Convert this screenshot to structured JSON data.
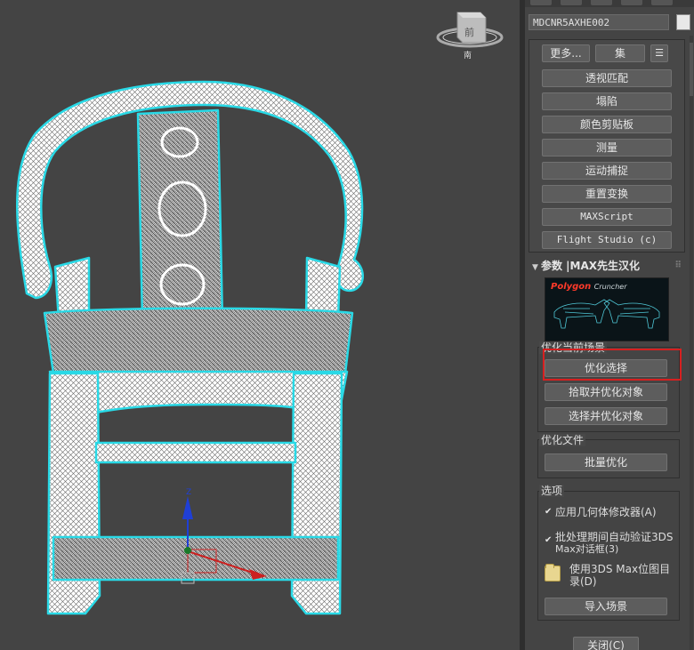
{
  "viewport": {
    "viewcube_top_label": "前",
    "viewcube_compass_label": "南",
    "gizmo_axis_label": "Z"
  },
  "panel": {
    "object_name": "MDCNR5AXHE002",
    "utility_buttons": {
      "more": "更多...",
      "sets": "集",
      "perspective_match": "透视匹配",
      "collapse": "塌陷",
      "color_clipboard": "颜色剪贴板",
      "measure": "测量",
      "motion_capture": "运动捕捉",
      "reset_xform": "重置变换",
      "maxscript": "MAXScript",
      "flight_studio": "Flight Studio (c)"
    },
    "params_header": "参数 |MAX先生汉化",
    "logo": {
      "brand": "Polygon",
      "product": "Cruncher"
    },
    "optimize_scene": {
      "label": "优化当前场景",
      "optimize_selection": "优化选择",
      "pick_and_optimize": "拾取并优化对象",
      "select_and_optimize": "选择并优化对象"
    },
    "optimize_files": {
      "label": "优化文件",
      "batch_optimize": "批量优化"
    },
    "options": {
      "label": "选项",
      "apply_modifiers": "应用几何体修改器(A)",
      "apply_modifiers_checked": true,
      "batch_autovalidate_line1": "批处理期间自动验证3DS",
      "batch_autovalidate_line2": "Max对话框(3)",
      "batch_autovalidate_checked": true,
      "use_bitmap_line1": "使用3DS Max位图目",
      "use_bitmap_line2": "录(D)",
      "import_scene": "导入场景"
    },
    "close": "关闭(C)"
  },
  "colors": {
    "viewport_bg": "#444444",
    "wire": "#ffffff",
    "selection_outline": "#29d9e6",
    "highlight_box": "#d62020"
  }
}
